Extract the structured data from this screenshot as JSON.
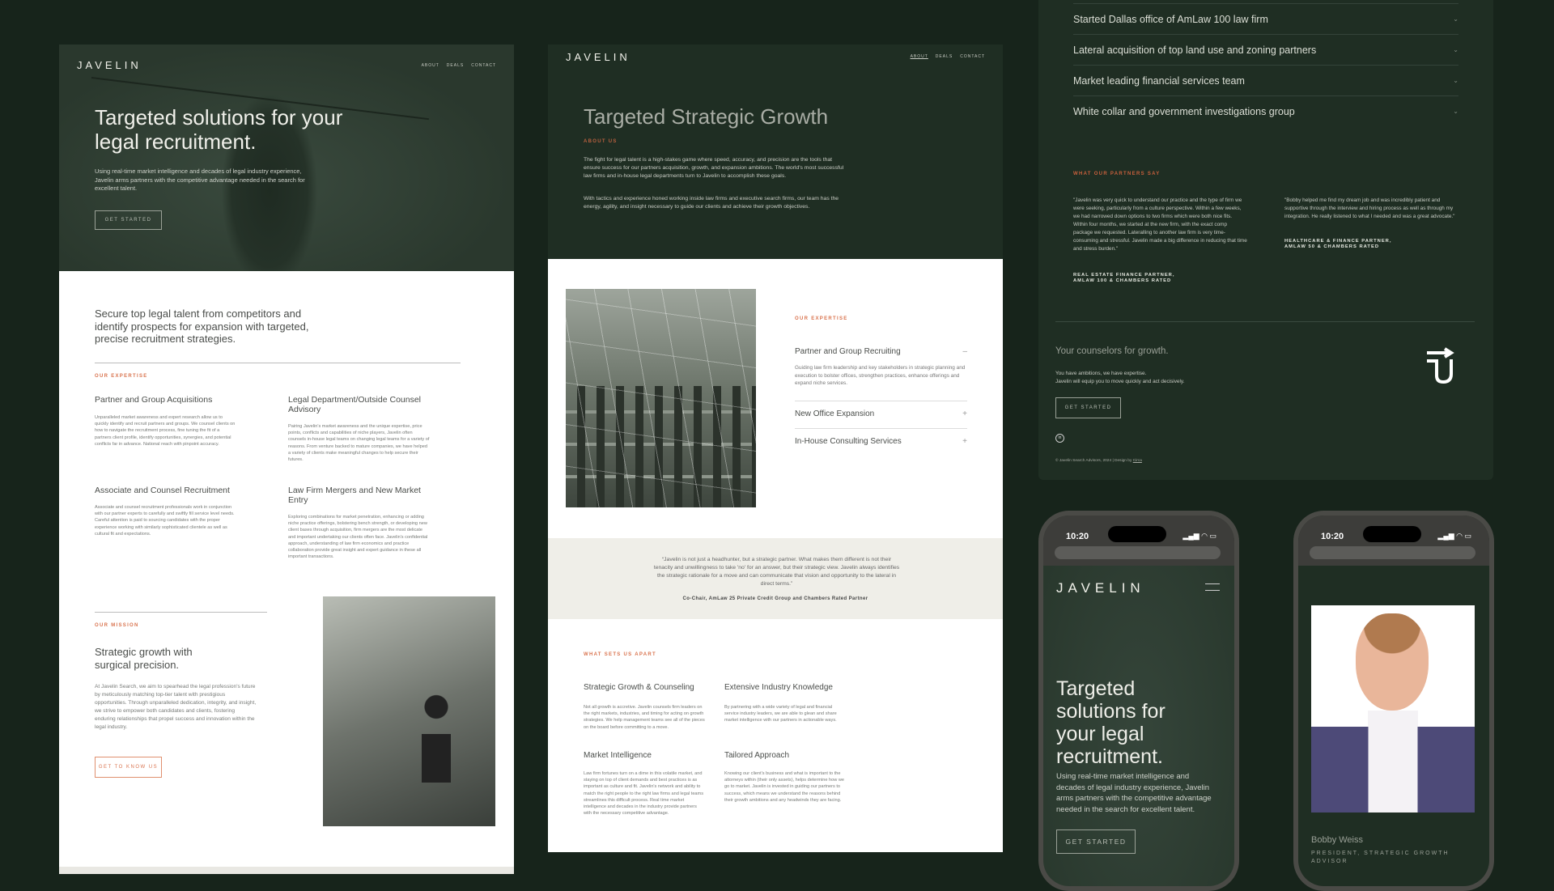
{
  "colors": {
    "background": "#17241b",
    "dark_green": "#223126",
    "accent": "#d9734e",
    "quote_band": "#efeee8"
  },
  "brand": "JAVELIN",
  "nav": [
    "ABOUT",
    "DEALS",
    "CONTACT"
  ],
  "home": {
    "hero_title": "Targeted solutions for your legal recruitment.",
    "hero_text": "Using real-time market intelligence and decades of legal industry experience, Javelin arms partners with the competitive advantage needed in the search for excellent talent.",
    "hero_button": "GET STARTED",
    "intro": "Secure top legal talent from competitors and identify prospects for expansion with targeted, precise recruitment strategies.",
    "expertise_label": "OUR EXPERTISE",
    "expertise": [
      {
        "title": "Partner and Group Acquisitions",
        "text": "Unparalleled market awareness and expert research allow us to quickly identify and recruit partners and groups. We counsel clients on how to navigate the recruitment process, fine tuning the fit of a partners client profile, identify opportunities, synergies, and potential conflicts far in advance. National reach with pinpoint accuracy."
      },
      {
        "title": "Legal Department/Outside Counsel Advisory",
        "text": "Pairing Javelin's market awareness and the unique expertise, price points, conflicts and capabilities of niche players, Javelin often counsels in-house legal teams on changing legal teams for a variety of reasons. From venture backed to mature companies, we have helped a variety of clients make meaningful changes to help secure their futures."
      },
      {
        "title": "Associate and Counsel Recruitment",
        "text": "Associate and counsel recruitment professionals work in conjunction with our partner experts to carefully and swiftly fill service level needs. Careful attention is paid to sourcing candidates with the proper experience working with similarly sophisticated clientele as well as cultural fit and expectations."
      },
      {
        "title": "Law Firm Mergers and New Market Entry",
        "text": "Exploring combinations for market penetration, enhancing or adding niche practice offerings, bolstering bench strength, or developing new client bases through acquisition, firm mergers are the most delicate and important undertaking our clients often face. Javelin's confidential approach, understanding of law firm economics and practice collaboration provide great insight and expert guidance in these all important transactions."
      }
    ],
    "mission_label": "OUR MISSION",
    "mission_title": "Strategic growth with surgical precision.",
    "mission_text": "At Javelin Search, we aim to spearhead the legal profession's future by meticulously matching top-tier talent with prestigious opportunities. Through unparalleled dedication, integrity, and insight, we strive to empower both candidates and clients, fostering enduring relationships that propel success and innovation within the legal industry.",
    "mission_button": "GET TO KNOW US"
  },
  "about": {
    "title": "Targeted Strategic Growth",
    "label": "ABOUT US",
    "p1": "The fight for legal talent is a high-stakes game where speed, accuracy, and precision are the tools that ensure success for our partners acquisition, growth, and expansion ambitions.  The world's most successful law firms and in-house legal departments turn to Javelin to accomplish these goals.",
    "p2": "With tactics and experience honed working inside law firms and executive search firms, our team has the energy, agility, and insight necessary to guide our clients and achieve their growth objectives.",
    "expertise_label": "OUR EXPERTISE",
    "accordion": [
      {
        "title": "Partner and Group Recruiting",
        "icon": "minus",
        "text": "Guiding law firm leadership and key stakeholders in strategic planning and execution to bolster offices, strengthen practices, enhance offerings and expand niche services."
      },
      {
        "title": "New Office Expansion",
        "icon": "+"
      },
      {
        "title": "In-House Consulting Services",
        "icon": "+"
      }
    ],
    "quote": "“Javelin is not just a headhunter, but a strategic partner. What makes them different is not their tenacity and unwillingness to take 'no' for an answer, but their strategic view. Javelin always identifies the strategic rationale for a move and can communicate that vision and opportunity to the lateral in direct terms.”",
    "quote_author": "Co-Chair, AmLaw 25 Private Credit Group and Chambers Rated Partner",
    "apart_label": "WHAT SETS US APART",
    "apart": [
      {
        "title": "Strategic Growth & Counseling",
        "text": "Not all growth is accretive. Javelin counsels firm leaders on the right markets, industries, and timing for acting on growth strategies. We help management teams see all of the pieces on the board before committing to a move."
      },
      {
        "title": "Extensive Industry Knowledge",
        "text": "By partnering with a wide variety of legal and financial service industry leaders, we are able to glean and share market intelligence with our partners in actionable ways."
      },
      {
        "title": "Market Intelligence",
        "text": "Law firm fortunes turn on a dime in this volatile market, and staying on top of client demands and best practices is as important as culture and fit. Javelin's network and ability to match the right people to the right law firms and legal teams streamlines this difficult process. Real time market intelligence and decades in the industry provide partners with the necessary competitive advantage."
      },
      {
        "title": "Tailored Approach",
        "text": "Knowing our client's business and what is important to the attorneys within (their only assets), helps determine how we go to market. Javelin is invested in guiding our partners to success, which means we understand the reasons behind their growth ambitions and any headwinds they are facing."
      }
    ]
  },
  "deals": {
    "items": [
      "Started Dallas office of AmLaw 100 law firm",
      "Lateral acquisition of top land use and zoning partners",
      "Market leading financial services team",
      "White collar and government investigations group"
    ],
    "testimonials_label": "WHAT OUR PARTNERS SAY",
    "testimonials": [
      {
        "quote": "\"Javelin was very quick to understand our practice and the type of firm we were seeking, particularly from a culture perspective. Within a few weeks, we had narrowed down options to two firms which were both nice fits. Within four months, we started at the new firm, with the exact comp package we requested. Lateralling to another law firm is very time-consuming and stressful.  Javelin made a big difference in reducing that time and stress burden.\"",
        "author": "REAL ESTATE FINANCE PARTNER, AMLAW 100 & CHAMBERS RATED"
      },
      {
        "quote": "\"Bobby helped me find my dream job and was incredibly patient and supportive through the interview and hiring process as well as through my integration.  He really listened to what I needed and was a great advocate.\"",
        "author": "HEALTHCARE & FINANCE PARTNER, AMLAW 50 & CHAMBERS RATED"
      }
    ],
    "footer_title": "Your counselors for growth.",
    "footer_line1": "You have ambitions, we have expertise.",
    "footer_line2": "Javelin will equip you to move quickly and act decisively.",
    "footer_button": "GET STARTED",
    "copyright": "© Javelin Search Advisors, 2024 | Design by",
    "design_link": "Circa"
  },
  "mobile": {
    "time": "10:20",
    "hero_title": "Targeted solutions for your legal recruitment.",
    "hero_text": "Using real-time market intelligence and decades of legal industry experience, Javelin arms partners with the competitive advantage needed in the search for excellent talent.",
    "hero_button": "GET STARTED",
    "person_name": "Bobby Weiss",
    "person_title": "PRESIDENT, STRATEGIC GROWTH ADVISOR"
  }
}
